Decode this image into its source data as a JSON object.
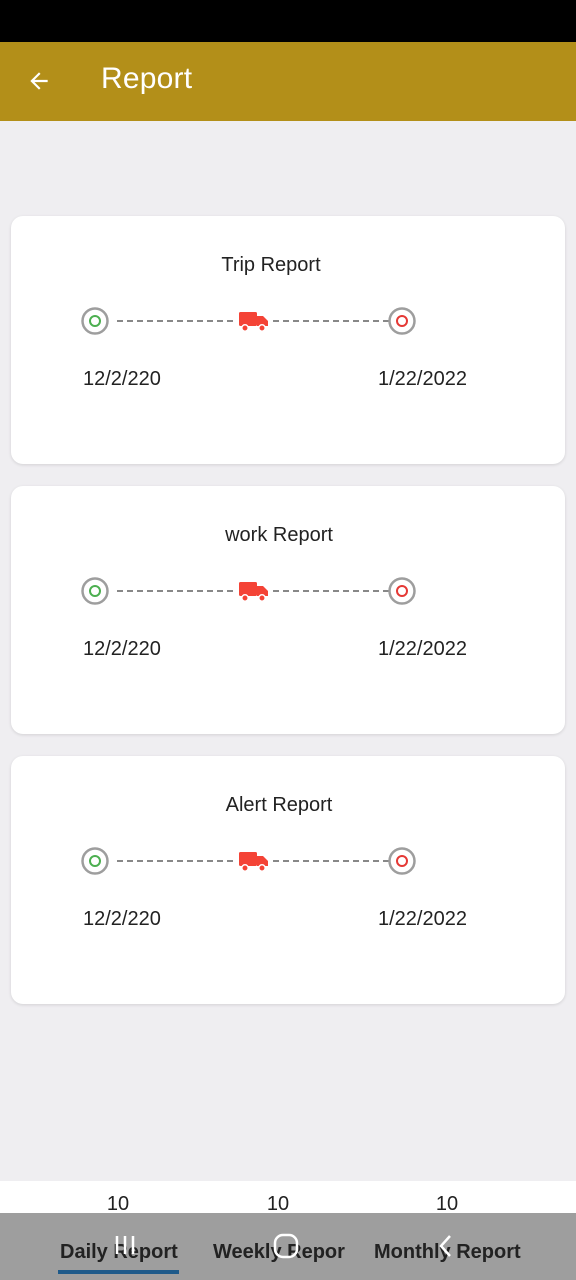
{
  "app_bar": {
    "title": "Report",
    "back_icon": "arrow-left-icon",
    "background": "#b38f19"
  },
  "cards": [
    {
      "title": "Trip Report",
      "start_date": "12/2/220",
      "end_date": "1/22/2022"
    },
    {
      "title": "work Report",
      "start_date": "12/2/220",
      "end_date": "1/22/2022"
    },
    {
      "title": "Alert Report",
      "start_date": "12/2/220",
      "end_date": "1/22/2022"
    }
  ],
  "route_icons": {
    "start": "start-point-icon",
    "vehicle": "truck-icon",
    "end": "end-point-icon",
    "start_color": "#4caf50",
    "end_color": "#e53935",
    "truck_color": "#f44336"
  },
  "tabs": {
    "counts": [
      "10",
      "10",
      "10"
    ],
    "labels": [
      "Daily Report",
      "Weekly Repor",
      "Monthly Report"
    ],
    "selected": "Daily Report",
    "indicator_color": "#1e5a8a"
  },
  "system_nav": {
    "recents_icon": "recents-icon",
    "home_icon": "home-icon",
    "back_icon": "back-chevron-icon"
  }
}
